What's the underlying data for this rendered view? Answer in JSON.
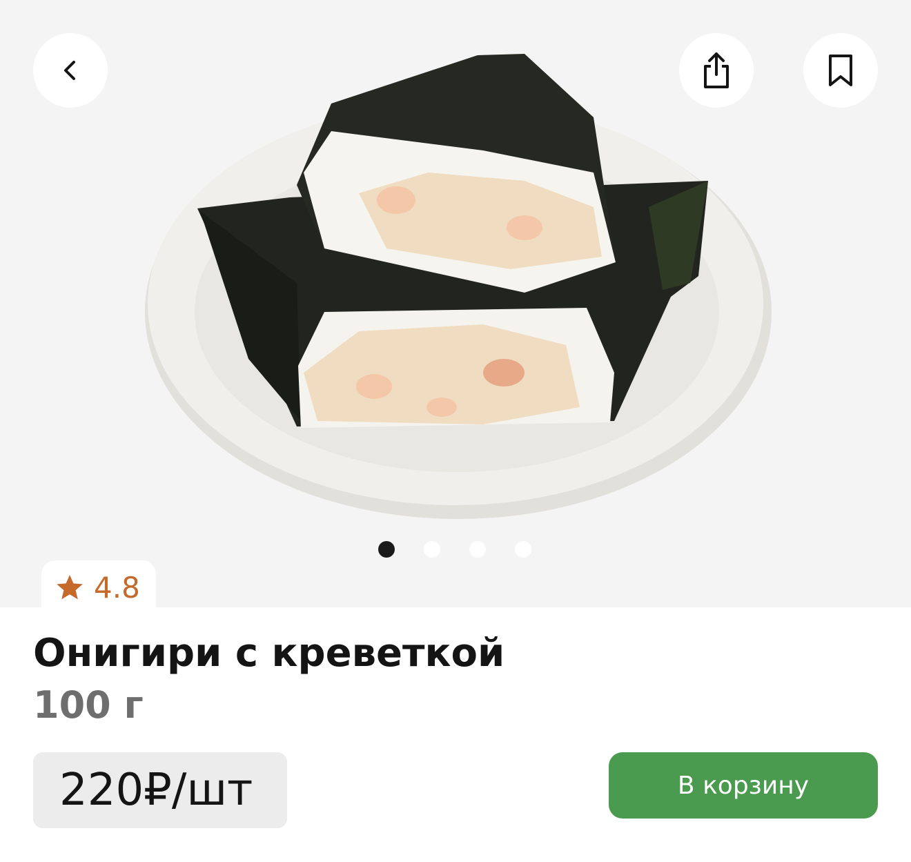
{
  "product": {
    "title": "Онигири с креветкой",
    "weight": "100 г",
    "price": "220₽/шт",
    "rating": "4.8"
  },
  "actions": {
    "add_to_cart_label": "В корзину"
  },
  "gallery": {
    "images_count": 4,
    "active_index": 0
  },
  "icons": {
    "back": "chevron-left-icon",
    "share": "share-icon",
    "bookmark": "bookmark-icon",
    "rating": "star-icon"
  },
  "colors": {
    "accent_green": "#4a9a4f",
    "rating_orange": "#c46a2a",
    "hero_background": "#f4f4f4"
  }
}
